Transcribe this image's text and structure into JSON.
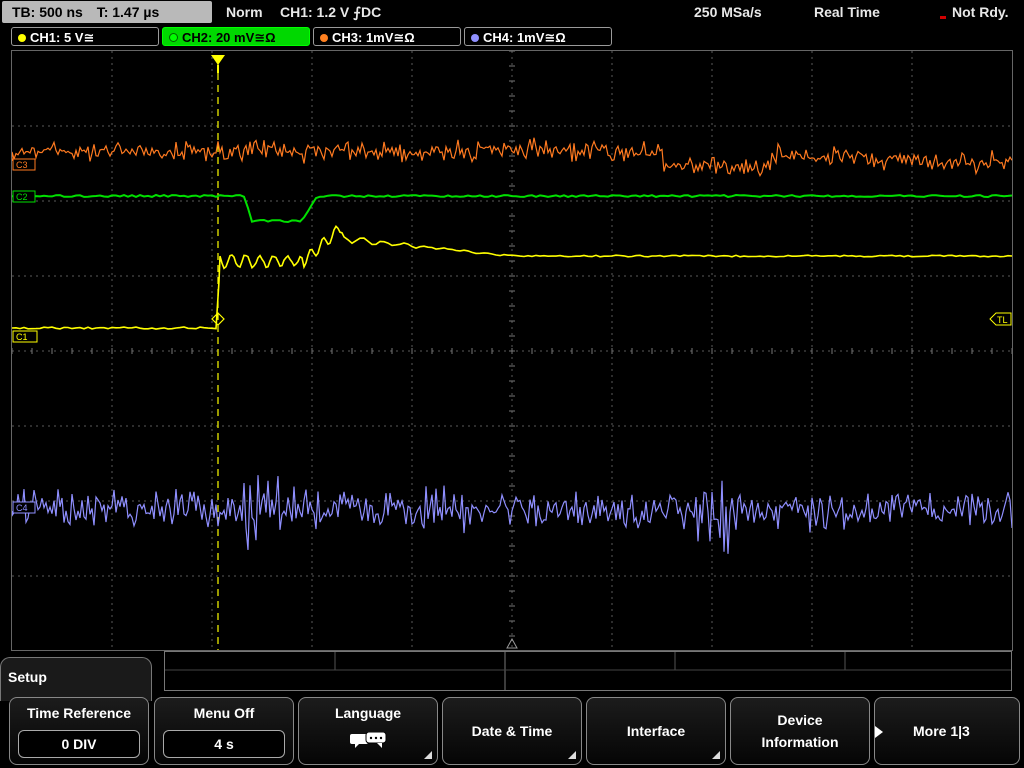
{
  "status": {
    "timebase": "TB: 500 ns",
    "trigger_time": "T: 1.47 µs",
    "mode": "Norm",
    "trigger": "CH1: 1.2 V ⨍DC",
    "sample_rate": "250 MSa/s",
    "acq_mode": "Real Time",
    "ready": "Not Rdy."
  },
  "channels": [
    {
      "label": "CH1: 5 V≅",
      "color": "#ffff00"
    },
    {
      "label": "CH2: 20 mV≅Ω",
      "color": "#00ff00"
    },
    {
      "label": "CH3: 1mV≅Ω",
      "color": "#ff8020"
    },
    {
      "label": "CH4: 1mV≅Ω",
      "color": "#9090ff"
    }
  ],
  "markers": {
    "c3": "C3",
    "c2": "C2",
    "c1": "C1",
    "c4": "C4",
    "tl": "TL"
  },
  "menu": {
    "title": "Setup",
    "time_reference": {
      "label": "Time Reference",
      "value": "0 DIV"
    },
    "menu_off": {
      "label": "Menu Off",
      "value": "4 s"
    },
    "language": {
      "label": "Language",
      "icon": "speech-bubbles-icon"
    },
    "date_time": {
      "label": "Date & Time"
    },
    "interface": {
      "label": "Interface"
    },
    "device_information": {
      "label_1": "Device",
      "label_2": "Information"
    },
    "more": {
      "label": "More 1|3"
    }
  }
}
